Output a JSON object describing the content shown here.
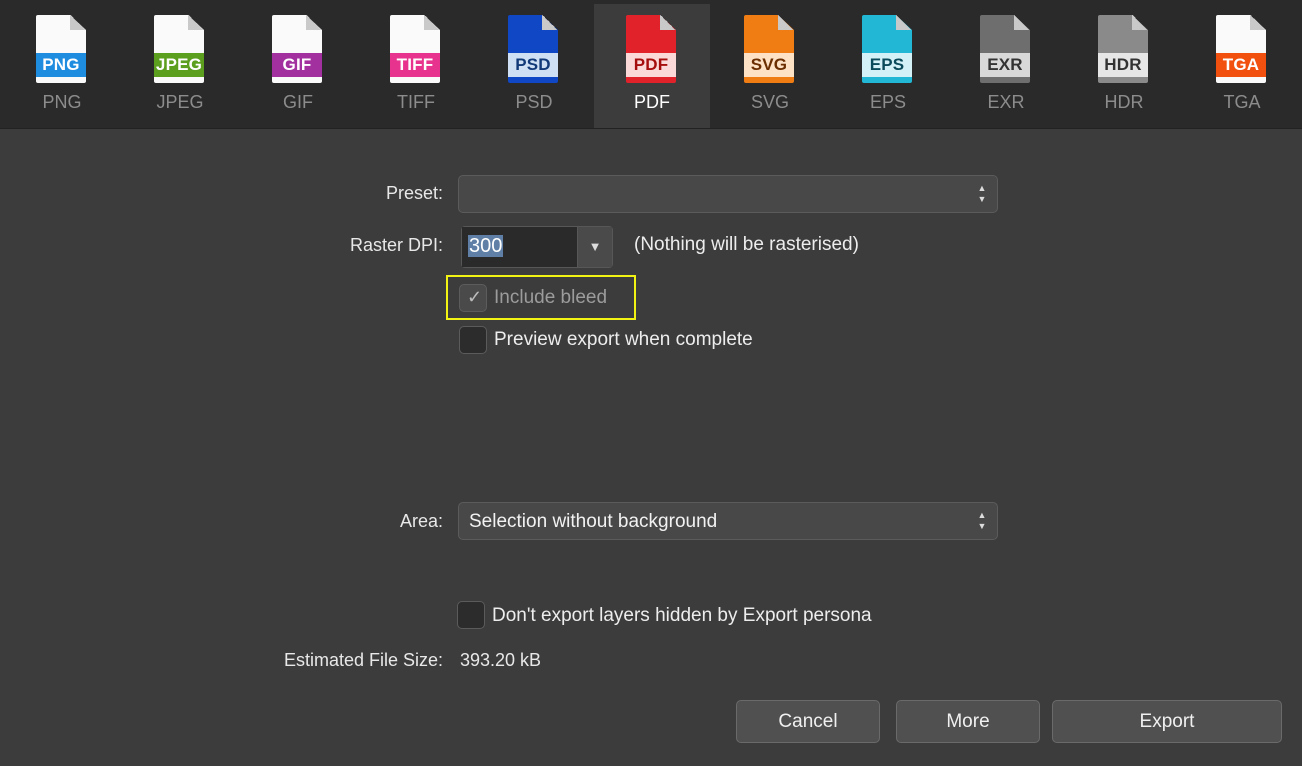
{
  "formats": [
    {
      "label": "PNG",
      "icon_text": "PNG",
      "band_color": "#1e8de0",
      "icon_text_color": "#ffffff",
      "selected": false
    },
    {
      "label": "JPEG",
      "icon_text": "JPEG",
      "band_color": "#5c9e1d",
      "icon_text_color": "#ffffff",
      "selected": false
    },
    {
      "label": "GIF",
      "icon_text": "GIF",
      "band_color": "#a2309f",
      "icon_text_color": "#ffffff",
      "selected": false
    },
    {
      "label": "TIFF",
      "icon_text": "TIFF",
      "band_color": "#e8338e",
      "icon_text_color": "#ffffff",
      "selected": false
    },
    {
      "label": "PSD",
      "icon_text": "PSD",
      "band_color": "#cfe0f5",
      "icon_text_color": "#123a78",
      "selected": false
    },
    {
      "label": "PDF",
      "icon_text": "PDF",
      "band_color": "#fbd9d9",
      "icon_text_color": "#a60e0e",
      "selected": true
    },
    {
      "label": "SVG",
      "icon_text": "SVG",
      "band_color": "#fde2c6",
      "icon_text_color": "#6b2e00",
      "selected": false
    },
    {
      "label": "EPS",
      "icon_text": "EPS",
      "band_color": "#d3f1f7",
      "icon_text_color": "#0b4a5a",
      "selected": false
    },
    {
      "label": "EXR",
      "icon_text": "EXR",
      "band_color": "#d8d8d8",
      "icon_text_color": "#333333",
      "selected": false
    },
    {
      "label": "HDR",
      "icon_text": "HDR",
      "band_color": "#e6e6e6",
      "icon_text_color": "#333333",
      "selected": false
    },
    {
      "label": "TGA",
      "icon_text": "TGA",
      "band_color": "#f2500f",
      "icon_text_color": "#ffffff",
      "selected": false
    }
  ],
  "icon_body_colors": {
    "PSD": "#1047c4",
    "PDF": "#e2222a",
    "SVG": "#f07d14",
    "EPS": "#22b7d4",
    "EXR": "#6e6e6e",
    "HDR": "#8a8a8a"
  },
  "form": {
    "preset_label": "Preset:",
    "preset_value": "",
    "raster_dpi_label": "Raster DPI:",
    "raster_dpi_value": "300",
    "raster_note": "(Nothing will be rasterised)",
    "include_bleed_label": "Include bleed",
    "include_bleed_checked": true,
    "preview_label": "Preview export when complete",
    "area_label": "Area:",
    "area_value": "Selection without background",
    "hidden_layers_label": "Don't export layers hidden by Export persona",
    "file_size_label": "Estimated File Size:",
    "file_size_value": "393.20 kB"
  },
  "buttons": {
    "cancel": "Cancel",
    "more": "More",
    "export": "Export"
  },
  "glyphs": {
    "check": "✓",
    "combo_arrow": "▼",
    "stepper_up": "▲",
    "stepper_down": "▼"
  },
  "highlight_color": "#f2f213"
}
